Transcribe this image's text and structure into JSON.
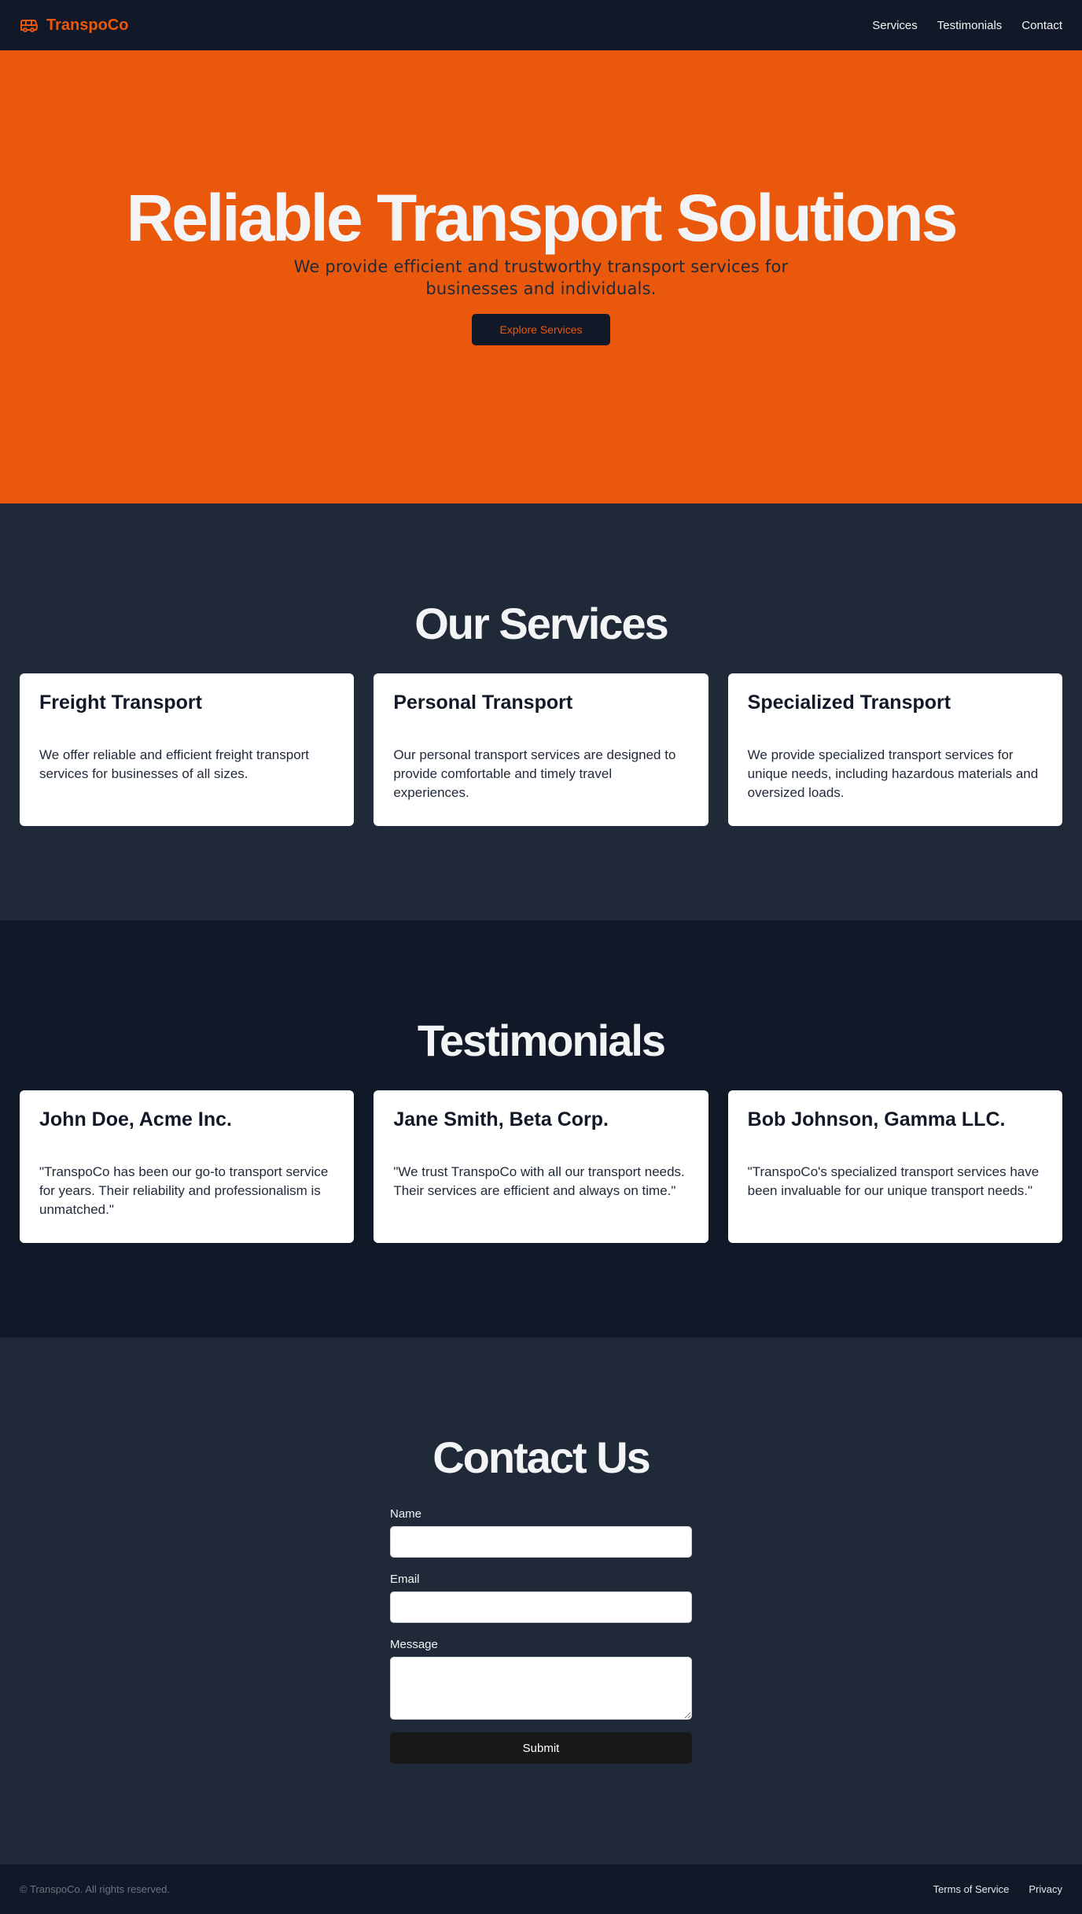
{
  "header": {
    "brand": "TranspoCo",
    "brand_icon": "bus-icon",
    "nav": [
      "Services",
      "Testimonials",
      "Contact"
    ]
  },
  "hero": {
    "title": "Reliable Transport Solutions",
    "subtitle": "We provide efficient and trustworthy transport services for businesses and individuals.",
    "cta": "Explore Services"
  },
  "services": {
    "title": "Our Services",
    "cards": [
      {
        "title": "Freight Transport",
        "text": "We offer reliable and efficient freight transport services for businesses of all sizes."
      },
      {
        "title": "Personal Transport",
        "text": "Our personal transport services are designed to provide comfortable and timely travel experiences."
      },
      {
        "title": "Specialized Transport",
        "text": "We provide specialized transport services for unique needs, including hazardous materials and oversized loads."
      }
    ]
  },
  "testimonials": {
    "title": "Testimonials",
    "cards": [
      {
        "title": "John Doe, Acme Inc.",
        "text": "\"TranspoCo has been our go-to transport service for years. Their reliability and professionalism is unmatched.\""
      },
      {
        "title": "Jane Smith, Beta Corp.",
        "text": "\"We trust TranspoCo with all our transport needs. Their services are efficient and always on time.\""
      },
      {
        "title": "Bob Johnson, Gamma LLC.",
        "text": "\"TranspoCo's specialized transport services have been invaluable for our unique transport needs.\""
      }
    ]
  },
  "contact": {
    "title": "Contact Us",
    "name_label": "Name",
    "email_label": "Email",
    "message_label": "Message",
    "name_value": "",
    "email_value": "",
    "message_value": "",
    "submit": "Submit"
  },
  "footer": {
    "copyright": "© TranspoCo. All rights reserved.",
    "links": [
      "Terms of Service",
      "Privacy"
    ]
  },
  "colors": {
    "accent": "#ea580c",
    "dark": "#111827",
    "slate": "#1f2937"
  }
}
